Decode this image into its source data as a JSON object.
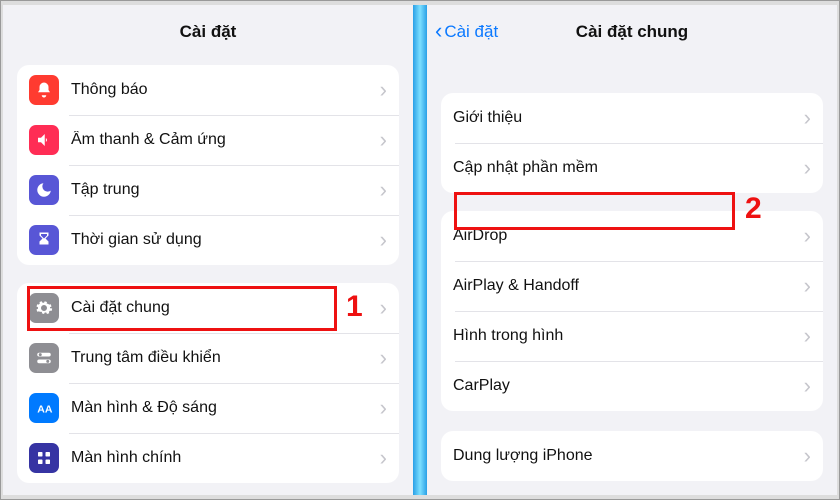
{
  "left": {
    "title": "Cài đặt",
    "group1": [
      {
        "icon": "notifications",
        "bg": "#ff3b30",
        "label": "Thông báo"
      },
      {
        "icon": "sound",
        "bg": "#ff2d55",
        "label": "Âm thanh & Cảm ứng"
      },
      {
        "icon": "moon",
        "bg": "#5856d6",
        "label": "Tập trung"
      },
      {
        "icon": "hourglass",
        "bg": "#5856d6",
        "label": "Thời gian sử dụng"
      }
    ],
    "group2": [
      {
        "icon": "gear",
        "bg": "#8e8e93",
        "label": "Cài đặt chung"
      },
      {
        "icon": "switches",
        "bg": "#8e8e93",
        "label": "Trung tâm điều khiển"
      },
      {
        "icon": "aa",
        "bg": "#007aff",
        "label": "Màn hình & Độ sáng"
      },
      {
        "icon": "grid",
        "bg": "#3634a3",
        "label": "Màn hình chính"
      }
    ]
  },
  "right": {
    "back": "Cài đặt",
    "title": "Cài đặt chung",
    "group1": [
      {
        "label": "Giới thiệu"
      },
      {
        "label": "Cập nhật phần mềm"
      }
    ],
    "group2": [
      {
        "label": "AirDrop"
      },
      {
        "label": "AirPlay & Handoff"
      },
      {
        "label": "Hình trong hình"
      },
      {
        "label": "CarPlay"
      }
    ],
    "group3": [
      {
        "label": "Dung lượng iPhone"
      }
    ]
  },
  "annotations": {
    "num1": "1",
    "num2": "2"
  }
}
